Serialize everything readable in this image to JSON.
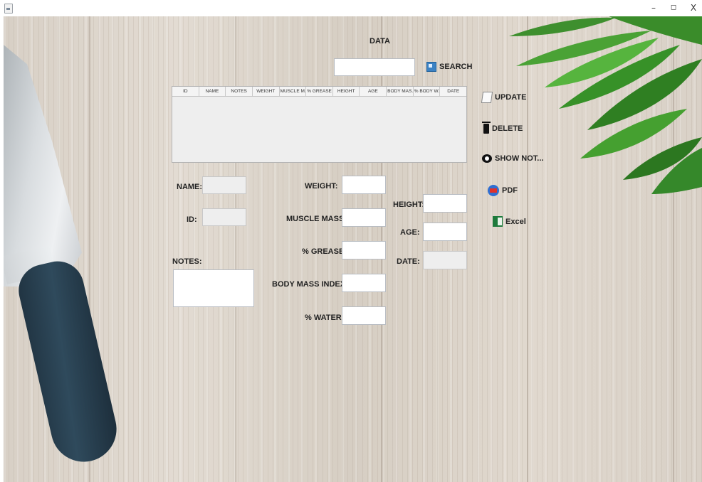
{
  "window": {
    "minimize": "–",
    "maximize": "◻",
    "close": "X"
  },
  "title": "DATA",
  "search": {
    "value": "",
    "button_label": "SEARCH"
  },
  "table": {
    "columns": [
      "ID",
      "NAME",
      "NOTES",
      "WEIGHT",
      "MUSCLE M...",
      "% GREASE",
      "HEIGHT",
      "AGE",
      "BODY MAS...",
      "% BODY W...",
      "DATE"
    ],
    "rows": []
  },
  "actions": {
    "update": "UPDATE",
    "delete": "DELETE",
    "show_notes": "SHOW NOT...",
    "pdf": "PDF",
    "excel": "Excel"
  },
  "form": {
    "name_label": "NAME:",
    "id_label": "ID:",
    "notes_label": "NOTES:",
    "weight_label": "WEIGHT:",
    "muscle_mass_label": "MUSCLE MASS:",
    "grease_label": "% GREASE:",
    "bmi_label": "BODY MASS INDEX:",
    "water_label": "% WATER:",
    "height_label": "HEIGHT:",
    "age_label": "AGE:",
    "date_label": "DATE:"
  },
  "icons": {
    "update": "edit-icon",
    "delete": "trash-icon",
    "show_notes": "eye-icon",
    "pdf": "pdf-icon",
    "excel": "excel-icon",
    "search": "search-icon"
  }
}
